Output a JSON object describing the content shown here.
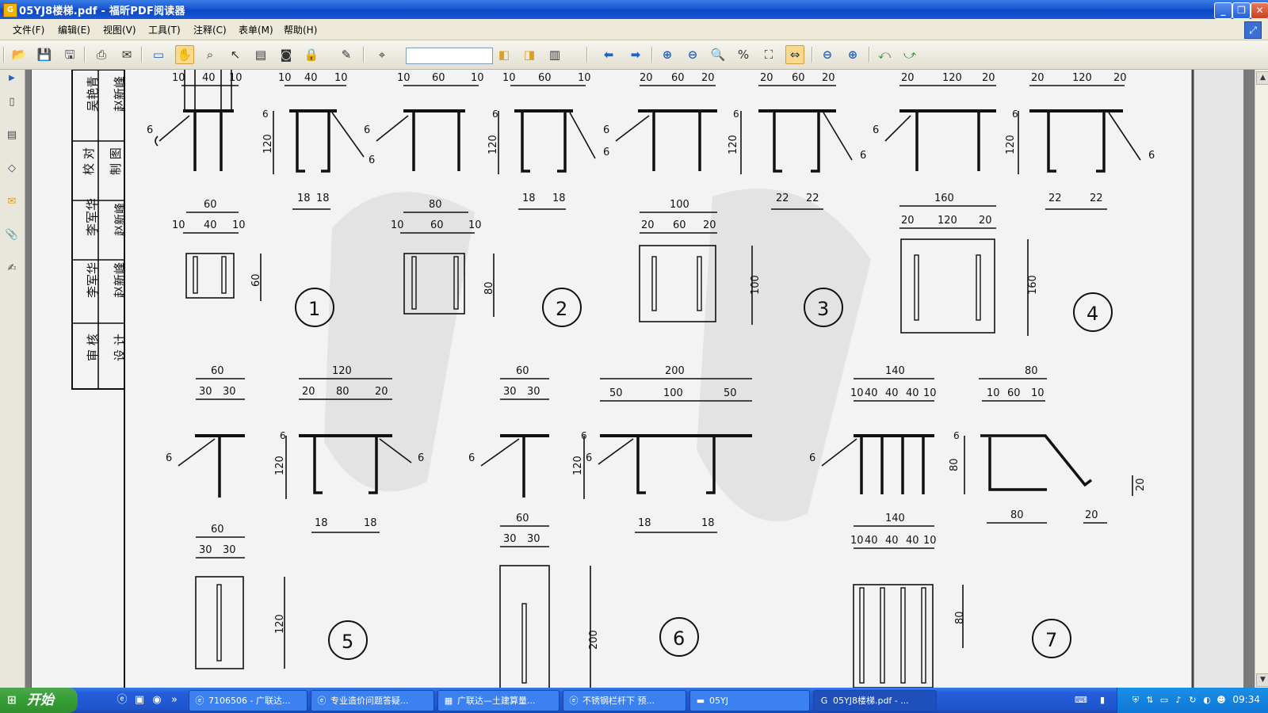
{
  "window": {
    "title": "05YJ8楼梯.pdf - 福昕PDF阅读器",
    "app_icon": "foxit-reader-icon",
    "controls": [
      "minimize",
      "restore",
      "close"
    ]
  },
  "menu": {
    "items": [
      "文件(F)",
      "编辑(E)",
      "视图(V)",
      "工具(T)",
      "注释(C)",
      "表单(M)",
      "帮助(H)"
    ]
  },
  "toolbar": {
    "find_value": "",
    "buttons": [
      "open-icon",
      "save-icon",
      "save-all-icon",
      "print-icon",
      "email-icon",
      "presentation-icon",
      "hand-tool-icon",
      "zoom-select-icon",
      "select-arrow-icon",
      "text-select-icon",
      "snapshot-icon",
      "rms-icon",
      "sign-icon",
      "find-icon",
      "prev-find-icon",
      "next-find-icon",
      "find-menu-icon",
      "back-icon",
      "forward-icon",
      "zoom-in-icon",
      "zoom-out-icon",
      "zoom-page-icon",
      "actual-size-icon",
      "fit-page-icon",
      "fit-width-icon",
      "zoom-minus-icon",
      "zoom-plus-icon",
      "rotate-left-icon",
      "rotate-right-icon"
    ]
  },
  "drawing": {
    "title_block": {
      "col_left": [
        "审核",
        "设计",
        "校对"
      ],
      "col_mid": [
        "李军华",
        "李军华",
        "吴艳青"
      ],
      "col_right": [
        "赵新峰",
        "赵新峰",
        "制图",
        "赵新峰"
      ]
    },
    "details": [
      {
        "num": "1",
        "top": [
          "10",
          "40",
          "10"
        ],
        "mid": [
          "10",
          "40",
          "10"
        ],
        "sub_top": "60",
        "sub_mid": [
          "10",
          "40",
          "10"
        ],
        "height": "120",
        "plate_h": "60",
        "legs": [
          "18",
          "18"
        ],
        "weld": "6"
      },
      {
        "num": "2",
        "top": [
          "10",
          "60",
          "10"
        ],
        "sub_top": "80",
        "sub_mid": [
          "10",
          "60",
          "10"
        ],
        "height": "120",
        "plate_h": "80",
        "legs": [
          "18",
          "18"
        ],
        "weld": "6"
      },
      {
        "num": "3",
        "top": [
          "20",
          "60",
          "20"
        ],
        "sub_top": "100",
        "sub_mid": [
          "20",
          "60",
          "20"
        ],
        "height": "120",
        "plate_h": "100",
        "legs": [
          "22",
          "22"
        ],
        "weld": "6"
      },
      {
        "num": "4",
        "top": [
          "20",
          "120",
          "20"
        ],
        "sub_top": "160",
        "sub_mid": [
          "20",
          "120",
          "20"
        ],
        "height": "120",
        "plate_h": "160",
        "legs": [
          "22",
          "22"
        ],
        "weld": "6"
      },
      {
        "num": "5",
        "top": "60",
        "halves": [
          "30",
          "30"
        ],
        "wide_top": "120",
        "wide_mid": [
          "20",
          "80",
          "20"
        ],
        "height": "120",
        "plate_h": "120",
        "legs": [
          "18",
          "18"
        ],
        "weld": "6"
      },
      {
        "num": "6",
        "top": "60",
        "halves": [
          "30",
          "30"
        ],
        "wide_top": "200",
        "wide_mid": [
          "50",
          "100",
          "50"
        ],
        "height": "120",
        "plate_h": "200",
        "legs": [
          "18",
          "18"
        ],
        "weld": "6"
      },
      {
        "num": "7",
        "top": "140",
        "mid": [
          "10",
          "40",
          "40",
          "40",
          "10"
        ],
        "right_top": "80",
        "right_mid": [
          "10",
          "60",
          "10"
        ],
        "height": "80",
        "bottom": "80",
        "hook": "20",
        "weld": "6"
      }
    ]
  },
  "taskbar": {
    "start_label": "开始",
    "tasks": [
      {
        "label": "7106506 - 广联达...",
        "icon": "ie-icon",
        "active": false
      },
      {
        "label": "专业造价问题答疑...",
        "icon": "ie-icon",
        "active": false
      },
      {
        "label": "广联达—土建算量...",
        "icon": "app-icon",
        "active": false
      },
      {
        "label": "不锈钢栏杆下 预...",
        "icon": "ie-icon",
        "active": false
      },
      {
        "label": "05YJ",
        "icon": "folder-icon",
        "active": false
      },
      {
        "label": "05YJ8楼梯.pdf - ...",
        "icon": "foxit-reader-icon",
        "active": true
      }
    ],
    "clock": "09:34"
  }
}
